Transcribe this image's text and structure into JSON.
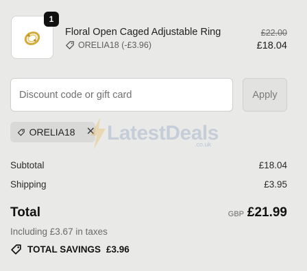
{
  "product": {
    "quantity": "1",
    "name": "Floral Open Caged Adjustable Ring",
    "discount_label": "ORELIA18 (-£3.96)",
    "original_price": "£22.00",
    "current_price": "£18.04",
    "thumbnail_icon": "gold-ring-image"
  },
  "discount": {
    "placeholder": "Discount code or gift card",
    "value": "",
    "apply_label": "Apply",
    "applied_code": "ORELIA18"
  },
  "watermark": {
    "brand": "LatestDeals",
    "sub": ".co.uk"
  },
  "summary": {
    "subtotal_label": "Subtotal",
    "subtotal_value": "£18.04",
    "shipping_label": "Shipping",
    "shipping_value": "£3.95",
    "total_label": "Total",
    "currency": "GBP",
    "total_value": "£21.99",
    "tax_note": "Including £3.67 in taxes",
    "savings_label": "TOTAL SAVINGS",
    "savings_value": "£3.96"
  },
  "colors": {
    "background": "#e9e9e7",
    "ring_gold": "#d4a93a"
  }
}
